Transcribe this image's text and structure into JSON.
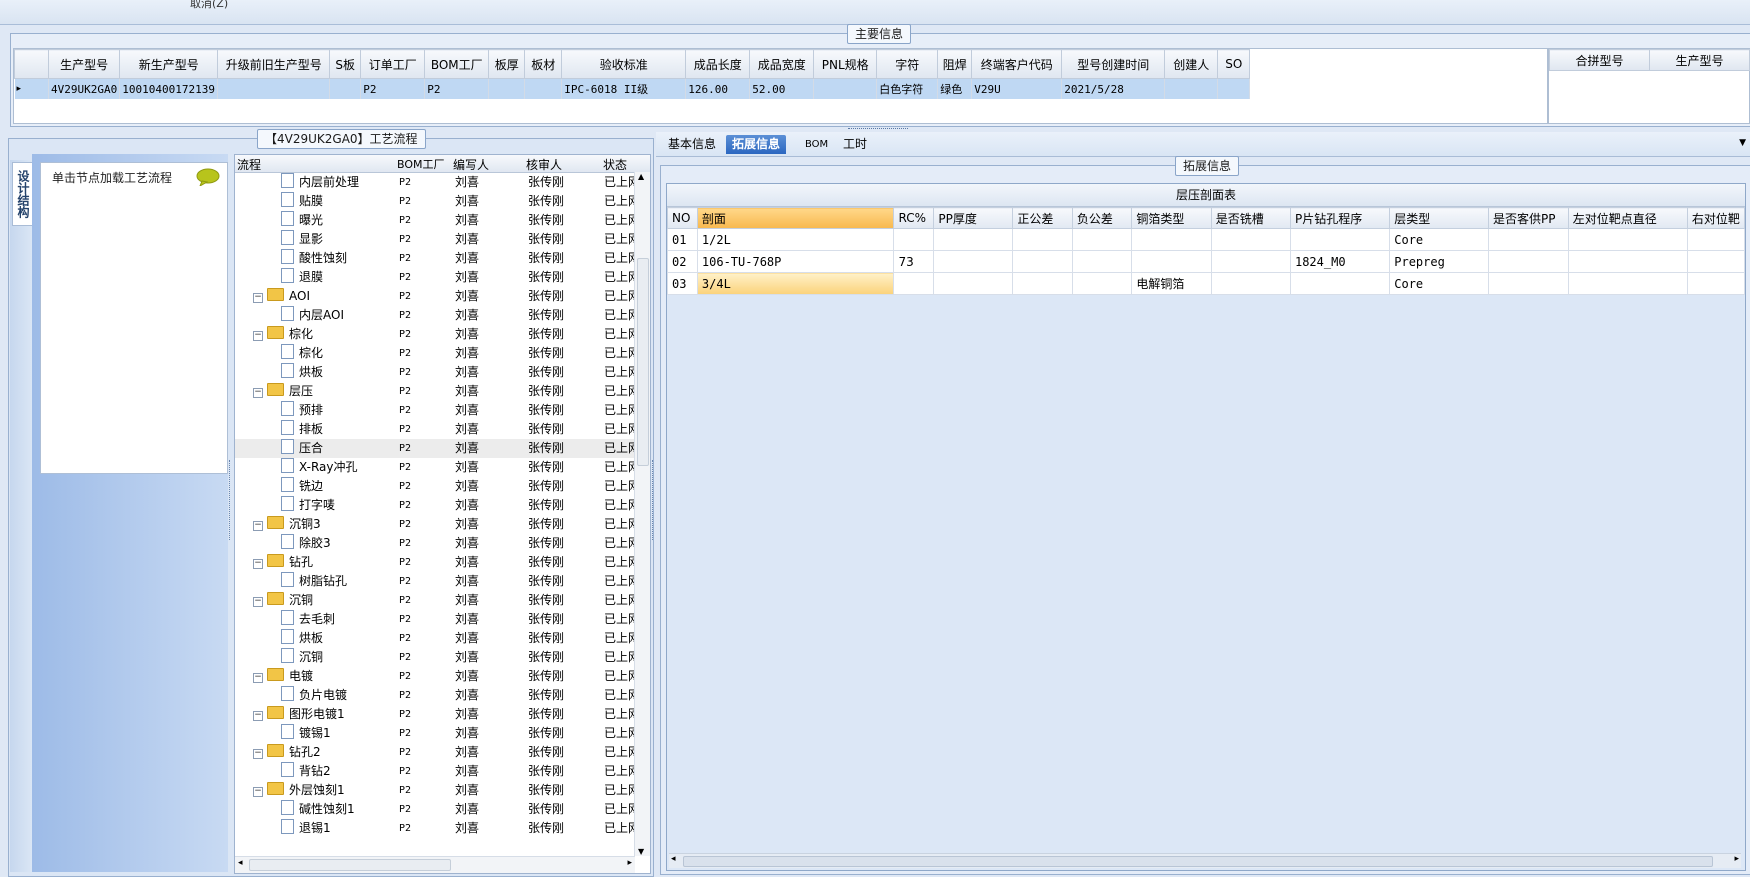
{
  "top": {
    "cancel_label": "取消(Z)"
  },
  "main_info": {
    "title": "主要信息",
    "columns": [
      "生产型号",
      "新生产型号",
      "升级前旧生产型号",
      "S板",
      "订单工厂",
      "BOM工厂",
      "板厚",
      "板材",
      "验收标准",
      "成品长度",
      "成品宽度",
      "PNL规格",
      "字符",
      "阻焊",
      "终端客户代码",
      "型号创建时间",
      "创建人",
      "SO"
    ],
    "row": [
      "4V29UK2GA0",
      "10010400172139",
      "",
      "",
      "P2",
      "P2",
      "",
      "",
      "IPC-6018 II级",
      "126.00",
      "52.00",
      "",
      "白色字符",
      "绿色",
      "V29U",
      "2021/5/28",
      "",
      ""
    ],
    "side_columns": [
      "合拼型号",
      "生产型号"
    ]
  },
  "process": {
    "title": "【4V29UK2GA0】工艺流程",
    "side_tab": "设计结构",
    "load_hint": "单击节点加载工艺流程",
    "columns": [
      "流程",
      "BOM工厂",
      "编写人",
      "核审人",
      "状态"
    ],
    "rows": [
      {
        "name": "内层前处理",
        "type": "leaf",
        "bom": "P2",
        "writer": "刘喜",
        "reviewer": "张传刚",
        "status": "已上网"
      },
      {
        "name": "贴膜",
        "type": "leaf",
        "bom": "P2",
        "writer": "刘喜",
        "reviewer": "张传刚",
        "status": "已上网"
      },
      {
        "name": "曝光",
        "type": "leaf",
        "bom": "P2",
        "writer": "刘喜",
        "reviewer": "张传刚",
        "status": "已上网"
      },
      {
        "name": "显影",
        "type": "leaf",
        "bom": "P2",
        "writer": "刘喜",
        "reviewer": "张传刚",
        "status": "已上网"
      },
      {
        "name": "酸性蚀刻",
        "type": "leaf",
        "bom": "P2",
        "writer": "刘喜",
        "reviewer": "张传刚",
        "status": "已上网"
      },
      {
        "name": "退膜",
        "type": "leaf",
        "bom": "P2",
        "writer": "刘喜",
        "reviewer": "张传刚",
        "status": "已上网"
      },
      {
        "name": "AOI",
        "type": "folder",
        "bom": "P2",
        "writer": "刘喜",
        "reviewer": "张传刚",
        "status": "已上网"
      },
      {
        "name": "内层AOI",
        "type": "leaf",
        "bom": "P2",
        "writer": "刘喜",
        "reviewer": "张传刚",
        "status": "已上网"
      },
      {
        "name": "棕化",
        "type": "folder",
        "bom": "P2",
        "writer": "刘喜",
        "reviewer": "张传刚",
        "status": "已上网"
      },
      {
        "name": "棕化",
        "type": "leaf",
        "bom": "P2",
        "writer": "刘喜",
        "reviewer": "张传刚",
        "status": "已上网"
      },
      {
        "name": "烘板",
        "type": "leaf",
        "bom": "P2",
        "writer": "刘喜",
        "reviewer": "张传刚",
        "status": "已上网"
      },
      {
        "name": "层压",
        "type": "folder",
        "bom": "P2",
        "writer": "刘喜",
        "reviewer": "张传刚",
        "status": "已上网"
      },
      {
        "name": "预排",
        "type": "leaf",
        "bom": "P2",
        "writer": "刘喜",
        "reviewer": "张传刚",
        "status": "已上网"
      },
      {
        "name": "排板",
        "type": "leaf",
        "bom": "P2",
        "writer": "刘喜",
        "reviewer": "张传刚",
        "status": "已上网"
      },
      {
        "name": "压合",
        "type": "leaf",
        "bom": "P2",
        "writer": "刘喜",
        "reviewer": "张传刚",
        "status": "已上网",
        "selected": true
      },
      {
        "name": "X-Ray冲孔",
        "type": "leaf",
        "bom": "P2",
        "writer": "刘喜",
        "reviewer": "张传刚",
        "status": "已上网"
      },
      {
        "name": "铣边",
        "type": "leaf",
        "bom": "P2",
        "writer": "刘喜",
        "reviewer": "张传刚",
        "status": "已上网"
      },
      {
        "name": "打字唛",
        "type": "leaf",
        "bom": "P2",
        "writer": "刘喜",
        "reviewer": "张传刚",
        "status": "已上网"
      },
      {
        "name": "沉铜3",
        "type": "folder",
        "bom": "P2",
        "writer": "刘喜",
        "reviewer": "张传刚",
        "status": "已上网"
      },
      {
        "name": "除胶3",
        "type": "leaf",
        "bom": "P2",
        "writer": "刘喜",
        "reviewer": "张传刚",
        "status": "已上网"
      },
      {
        "name": "钻孔",
        "type": "folder",
        "bom": "P2",
        "writer": "刘喜",
        "reviewer": "张传刚",
        "status": "已上网"
      },
      {
        "name": "树脂钻孔",
        "type": "leaf",
        "bom": "P2",
        "writer": "刘喜",
        "reviewer": "张传刚",
        "status": "已上网"
      },
      {
        "name": "沉铜",
        "type": "folder",
        "bom": "P2",
        "writer": "刘喜",
        "reviewer": "张传刚",
        "status": "已上网"
      },
      {
        "name": "去毛刺",
        "type": "leaf",
        "bom": "P2",
        "writer": "刘喜",
        "reviewer": "张传刚",
        "status": "已上网"
      },
      {
        "name": "烘板",
        "type": "leaf",
        "bom": "P2",
        "writer": "刘喜",
        "reviewer": "张传刚",
        "status": "已上网"
      },
      {
        "name": "沉铜",
        "type": "leaf",
        "bom": "P2",
        "writer": "刘喜",
        "reviewer": "张传刚",
        "status": "已上网"
      },
      {
        "name": "电镀",
        "type": "folder",
        "bom": "P2",
        "writer": "刘喜",
        "reviewer": "张传刚",
        "status": "已上网"
      },
      {
        "name": "负片电镀",
        "type": "leaf",
        "bom": "P2",
        "writer": "刘喜",
        "reviewer": "张传刚",
        "status": "已上网"
      },
      {
        "name": "图形电镀1",
        "type": "folder",
        "bom": "P2",
        "writer": "刘喜",
        "reviewer": "张传刚",
        "status": "已上网"
      },
      {
        "name": "镀锡1",
        "type": "leaf",
        "bom": "P2",
        "writer": "刘喜",
        "reviewer": "张传刚",
        "status": "已上网"
      },
      {
        "name": "钻孔2",
        "type": "folder",
        "bom": "P2",
        "writer": "刘喜",
        "reviewer": "张传刚",
        "status": "已上网"
      },
      {
        "name": "背钻2",
        "type": "leaf",
        "bom": "P2",
        "writer": "刘喜",
        "reviewer": "张传刚",
        "status": "已上网"
      },
      {
        "name": "外层蚀刻1",
        "type": "folder",
        "bom": "P2",
        "writer": "刘喜",
        "reviewer": "张传刚",
        "status": "已上网"
      },
      {
        "name": "碱性蚀刻1",
        "type": "leaf",
        "bom": "P2",
        "writer": "刘喜",
        "reviewer": "张传刚",
        "status": "已上网"
      },
      {
        "name": "退锡1",
        "type": "leaf",
        "bom": "P2",
        "writer": "刘喜",
        "reviewer": "张传刚",
        "status": "已上网"
      }
    ]
  },
  "right": {
    "tabs": [
      "基本信息",
      "拓展信息",
      "BOM",
      "工时"
    ],
    "active_tab": "拓展信息",
    "group_title": "拓展信息",
    "table_title": "层压剖面表",
    "columns": [
      "NO",
      "剖面",
      "RC%",
      "PP厚度",
      "正公差",
      "负公差",
      "铜箔类型",
      "是否铣槽",
      "P片钻孔程序",
      "层类型",
      "是否客供PP",
      "左对位靶点直径",
      "右对位靶"
    ],
    "rows": [
      [
        "01",
        "1/2L",
        "",
        "",
        "",
        "",
        "",
        "",
        "",
        "Core",
        "",
        "",
        ""
      ],
      [
        "02",
        "106-TU-768P",
        "73",
        "",
        "",
        "",
        "",
        "",
        "1824_M0",
        "Prepreg",
        "",
        "",
        ""
      ],
      [
        "03",
        "3/4L",
        "",
        "",
        "",
        "",
        "电解铜箔",
        "",
        "",
        "Core",
        "",
        "",
        ""
      ]
    ]
  },
  "colors": {
    "accent": "#2b67c0",
    "highlight": "#f7b84e",
    "selection": "#bfd8f3"
  }
}
